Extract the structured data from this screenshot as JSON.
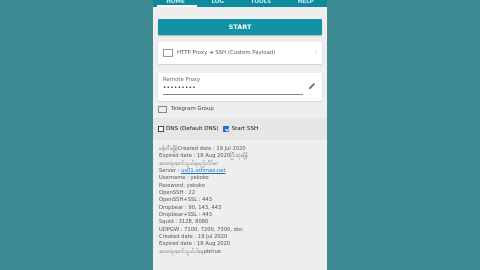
{
  "tabs": [
    "HOME",
    "LOG",
    "TOOLS",
    "HELP"
  ],
  "start_label": "START",
  "payload": {
    "label": "HTTP Proxy ➔ SSH (Custom Payload)",
    "chevron": "›"
  },
  "proxy": {
    "label": "Remote Proxy",
    "value": "•••••••••"
  },
  "telegram": "Telegram Group",
  "dns": {
    "label": "DNS (Default DNS)",
    "checked": false
  },
  "start_ssh": {
    "label": "Start SSH",
    "checked": true
  },
  "info_lines": [
    "ဖန်တီးချိန်Created date : 19 Jul 2020",
    "Expired date : 18 Aug 2020ပြီးဆုံးချိန်",
    "ဆာဗာမှဆက်သွယ်ရမည့်လိပ်စာ",
    "Server :",
    "Username : yekoko",
    "Password: yekoko",
    "OpenSSH : 22",
    "OpenSSH+SSL : 443",
    "Dropbear : 90, 143, 443",
    "Dropbear+SSL : 443",
    "Squid : 3128, 8080",
    "UDPGW : 7100, 7200, 7300, doc",
    "Created date : 19 Jul 2020",
    "Expired date : 18 Aug 2020",
    "",
    "ဆာဗာမှဆက်သွယ်ပါနေpbtrue"
  ],
  "server_link": "us01.sshmax.net"
}
